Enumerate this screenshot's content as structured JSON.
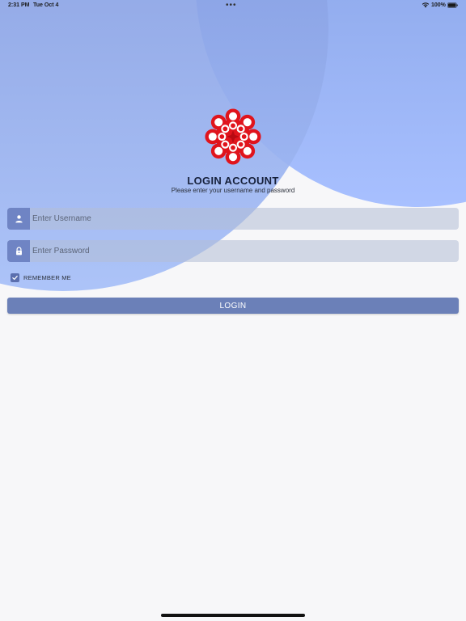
{
  "status_bar": {
    "time": "2:31 PM",
    "date": "Tue Oct 4",
    "multitask_dots": "•••",
    "battery_percent": "100%",
    "icons": [
      "wifi-icon",
      "battery-icon"
    ]
  },
  "logo": {
    "name": "flower-logo",
    "colors": {
      "primary": "#e0141c",
      "secondary": "#ffffff"
    }
  },
  "header": {
    "title": "LOGIN ACCOUNT",
    "subtitle": "Please enter your username and password"
  },
  "form": {
    "username": {
      "placeholder": "Enter Username",
      "value": "",
      "icon": "user-icon"
    },
    "password": {
      "placeholder": "Enter Password",
      "value": "",
      "icon": "lock-icon"
    },
    "remember_me": {
      "label": "REMEMBER ME",
      "checked": true
    },
    "login_label": "LOGIN"
  },
  "colors": {
    "accent": "#6b80b8",
    "icon_box": "#6f84c4",
    "background": "#f7f7f9",
    "decor_circle": "#8ea8ec"
  }
}
